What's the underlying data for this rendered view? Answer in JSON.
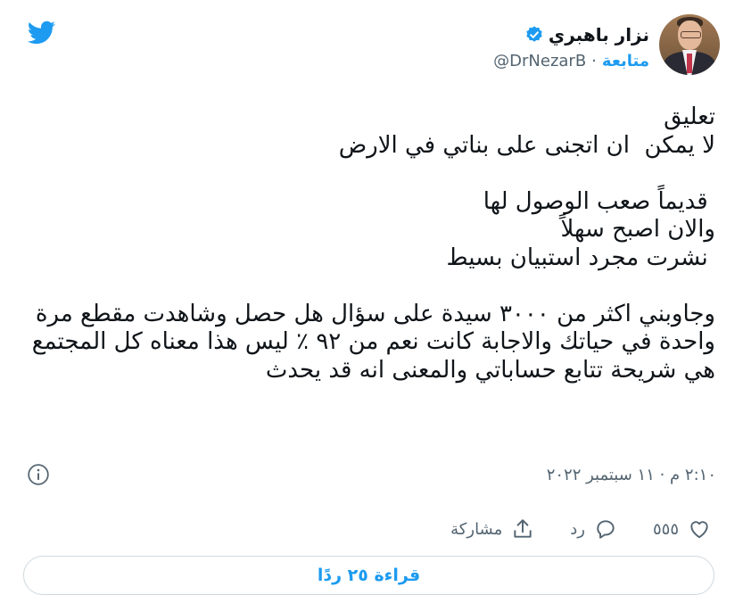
{
  "author": {
    "display_name": "نزار باهبري",
    "handle": "@DrNezarB",
    "follow_label": "متابعة",
    "verified": true,
    "separator": "·"
  },
  "tweet": {
    "text": "تعليق\nلا يمكن  ان اتجنى على بناتي في الارض\n\n قديماً صعب الوصول لها\nوالان اصبح سهلاً\n نشرت مجرد استبيان بسيط\n\nوجاوبني اكثر من ٣٠٠٠ سيدة على سؤال هل حصل وشاهدت مقطع مرة واحدة في حياتك والاجابة كانت نعم من ٩٢ ٪ ليس هذا معناه كل المجتمع هي شريحة تتابع حساباتي والمعنى انه قد يحدث",
    "timestamp": "٢:١٠ م · ١١ سبتمبر ٢٠٢٢"
  },
  "actions": {
    "like_count": "٥٥٥",
    "reply_label": "رد",
    "share_label": "مشاركة"
  },
  "read_replies_label": "قراءة ٢٥ ردًا",
  "icons": {
    "logo": "twitter-bird-icon",
    "verified": "verified-badge-icon",
    "info": "info-icon",
    "like": "heart-icon",
    "reply": "speech-bubble-icon",
    "share": "share-upload-icon"
  },
  "colors": {
    "accent": "#1d9bf0",
    "text": "#0f1419",
    "secondary_text": "#536471",
    "border": "#cfd9de"
  }
}
